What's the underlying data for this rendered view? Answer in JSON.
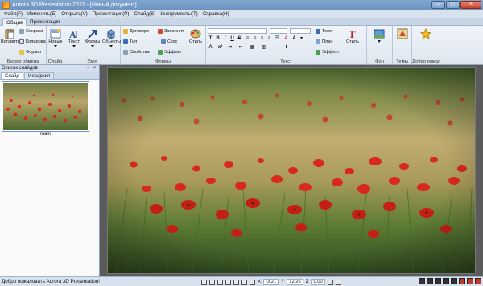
{
  "window": {
    "title": "Aurora 3D Presentation 2012 - [Новый документ]",
    "minimize": "–",
    "maximize": "□",
    "close": "×"
  },
  "menu": [
    "Файл(F)",
    "Изменить(E)",
    "Открыть(V)",
    "Презентация(P)",
    "Слайд(S)",
    "Инструменты(T)",
    "Справка(H)"
  ],
  "ribbon_tabs": [
    "Общие",
    "Презентация"
  ],
  "ribbon": {
    "clipboard": {
      "paste": "Вставить",
      "cut": "Сократи",
      "copy": "Копирова",
      "format": "Формат",
      "label": "Буфер обмена"
    },
    "slide": {
      "new": "Новые",
      "label": "Слайд"
    },
    "node": {
      "text": "Текст",
      "shapes": "Формы",
      "objects": "Объекты",
      "label": "Узел"
    },
    "shapes": {
      "contract": "Договоре",
      "fill": "Заполнят",
      "type": "Тип",
      "bevel": "Скос",
      "props": "Свойства",
      "effect": "Эффект",
      "style": "Стиль",
      "label": "Формы"
    },
    "text": {
      "text": "Текст",
      "plan": "План",
      "effect": "Эффект",
      "style": "Стиль",
      "label": "Текст"
    },
    "background": {
      "label": "Фон"
    },
    "themes": {
      "label": "Темы"
    },
    "welcome": {
      "label": "Добро пожаловать"
    }
  },
  "sidepanel": {
    "title": "Список слайдов",
    "tabs": [
      "Слайд",
      "Иерархия"
    ],
    "slide_caption": "main"
  },
  "statusbar": {
    "message": "Добро пожаловать Aurora 3D Presentation!",
    "x": "-3.21",
    "y": "12.26",
    "z": "0.00",
    "x_label": "X",
    "y_label": "Y",
    "z_label": "Z"
  },
  "colors": {
    "poppy": "#d8291c",
    "grass": "#6b8a3a",
    "accent": "#6b93bf"
  }
}
